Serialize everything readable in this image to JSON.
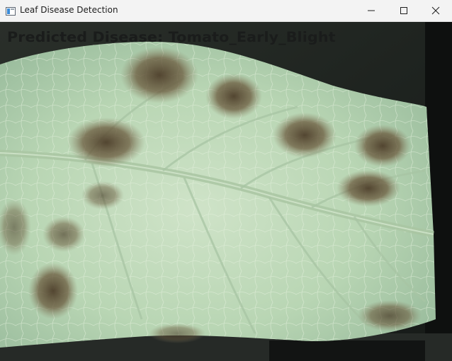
{
  "window": {
    "title": "Leaf Disease Detection",
    "app_icon": "window-app-icon",
    "controls": {
      "minimize_icon": "minimize-icon",
      "maximize_icon": "maximize-icon",
      "close_icon": "close-icon"
    }
  },
  "camera_feed": {
    "subject": "tomato-leaf-image",
    "prediction": {
      "label": "Predicted Disease: Tomato_Early_Blight"
    }
  }
}
